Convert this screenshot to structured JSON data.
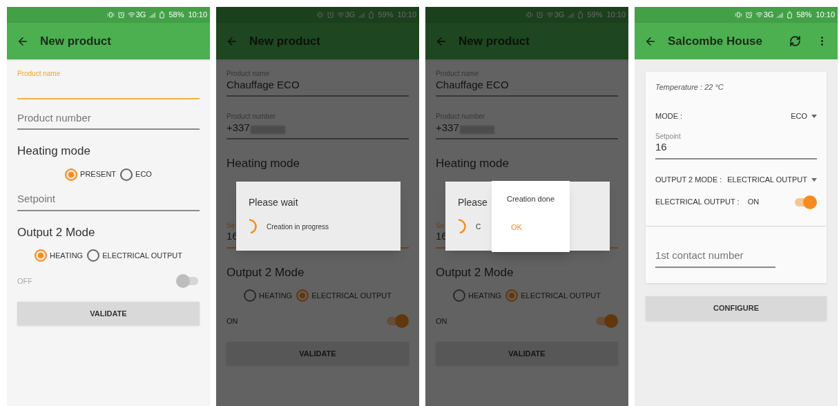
{
  "screens": [
    {
      "status": {
        "network": "3G",
        "battery": "58%",
        "time": "10:10"
      },
      "title": "New product",
      "items": [
        {
          "kind": "field",
          "label": "Product name",
          "focused": true
        },
        {
          "kind": "field",
          "placeholder": "Product number",
          "focused": false
        },
        {
          "kind": "heading",
          "text": "Heating mode"
        },
        {
          "kind": "radios",
          "options": [
            {
              "label": "PRESENT",
              "selected": true
            },
            {
              "label": "ECO",
              "selected": false
            }
          ]
        },
        {
          "kind": "field",
          "placeholder": "Setpoint",
          "focused": false
        },
        {
          "kind": "heading",
          "text": "Output 2 Mode"
        },
        {
          "kind": "radios",
          "options": [
            {
              "label": "HEATING",
              "selected": true
            },
            {
              "label": "ELECTRICAL OUTPUT",
              "selected": false
            }
          ]
        },
        {
          "kind": "switch",
          "state_text": "OFF",
          "on": false
        },
        {
          "kind": "button",
          "text": "VALIDATE"
        }
      ]
    },
    {
      "status": {
        "network": "3G",
        "battery": "59%",
        "time": "10:10"
      },
      "title": "New product",
      "dimmed": true,
      "items": [
        {
          "kind": "field",
          "label": "Product name",
          "value": "Chauffage ECO",
          "focused": false
        },
        {
          "kind": "field",
          "label": "Product number",
          "value": "+337",
          "redacted": true,
          "focused": false
        },
        {
          "kind": "heading",
          "text": "Heating mode"
        },
        {
          "kind": "field",
          "label": "Se",
          "value": "16",
          "focused": true
        },
        {
          "kind": "heading",
          "text": "Output 2 Mode"
        },
        {
          "kind": "radios",
          "options": [
            {
              "label": "HEATING",
              "selected": false
            },
            {
              "label": "ELECTRICAL OUTPUT",
              "selected": true
            }
          ]
        },
        {
          "kind": "switch",
          "state_text": "ON",
          "on": true
        },
        {
          "kind": "button",
          "text": "VALIDATE"
        }
      ],
      "dialogs": [
        {
          "kind": "progress",
          "title": "Please wait",
          "message": "Creation in progress"
        }
      ]
    },
    {
      "status": {
        "network": "3G",
        "battery": "59%",
        "time": "10:10"
      },
      "title": "New product",
      "dimmed": true,
      "items": [
        {
          "kind": "field",
          "label": "Product name",
          "value": "Chauffage ECO",
          "focused": false
        },
        {
          "kind": "field",
          "label": "Product number",
          "value": "+337",
          "redacted": true,
          "focused": false
        },
        {
          "kind": "heading",
          "text": "Heating mode"
        },
        {
          "kind": "field",
          "label": "Se",
          "value": "16",
          "focused": true
        },
        {
          "kind": "heading",
          "text": "Output 2 Mode"
        },
        {
          "kind": "radios",
          "options": [
            {
              "label": "HEATING",
              "selected": false
            },
            {
              "label": "ELECTRICAL OUTPUT",
              "selected": true
            }
          ]
        },
        {
          "kind": "switch",
          "state_text": "ON",
          "on": true
        },
        {
          "kind": "button",
          "text": "VALIDATE"
        }
      ],
      "dialogs": [
        {
          "kind": "progress",
          "title": "Please",
          "message": "C"
        },
        {
          "kind": "alert",
          "message": "Creation done",
          "button": "OK"
        }
      ]
    },
    {
      "status": {
        "network": "3G",
        "battery": "58%",
        "time": "10:10"
      },
      "title": "Salcombe House",
      "actions": true,
      "cards": [
        {
          "items": [
            {
              "kind": "info",
              "text": "Temperature : 22 °C"
            },
            {
              "kind": "dropdown",
              "label": "MODE :",
              "value": "ECO"
            },
            {
              "kind": "field",
              "label": "Setpoint",
              "value": "16",
              "focused": false
            },
            {
              "kind": "dropdown",
              "label": "OUTPUT 2 MODE :",
              "value": "ELECTRICAL OUTPUT"
            },
            {
              "kind": "switch",
              "label": "ELECTRICAL OUTPUT :",
              "state_text": "ON",
              "on": true
            }
          ]
        },
        {
          "items": [
            {
              "kind": "field",
              "placeholder": "1st contact number",
              "focused": false,
              "short": true
            }
          ]
        }
      ],
      "button": "CONFIGURE"
    }
  ]
}
